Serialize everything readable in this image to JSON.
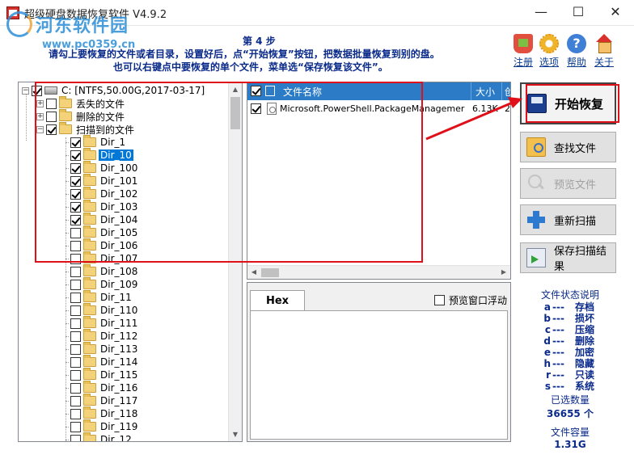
{
  "window": {
    "title": "超级硬盘数据恢复软件 V4.9.2",
    "min": "—",
    "max": "☐",
    "close": "✕"
  },
  "watermark": {
    "name": "河东软件园",
    "url": "www.pc0359.cn"
  },
  "instructions": {
    "step": "第 4 步",
    "line1": "请勾上要恢复的文件或者目录，设置好后，点“开始恢复”按钮，把数据批量恢复到别的盘。",
    "line2": "也可以右键点中要恢复的单个文件，菜单选“保存恢复该文件”。"
  },
  "toolbar": {
    "register": "注册",
    "options": "选项",
    "help": "帮助",
    "about": "关于"
  },
  "tree": {
    "drive": "C:  [NTFS,50.00G,2017-03-17]",
    "lost": "丢失的文件",
    "deleted": "删除的文件",
    "scanned": "扫描到的文件",
    "dirs": [
      "Dir_1",
      "Dir_10",
      "Dir_100",
      "Dir_101",
      "Dir_102",
      "Dir_103",
      "Dir_104",
      "Dir_105",
      "Dir_106",
      "Dir_107",
      "Dir_108",
      "Dir_109",
      "Dir_11",
      "Dir_110",
      "Dir_111",
      "Dir_112",
      "Dir_113",
      "Dir_114",
      "Dir_115",
      "Dir_116",
      "Dir_117",
      "Dir_118",
      "Dir_119",
      "Dir_12"
    ]
  },
  "filelist": {
    "col_name": "文件名称",
    "col_size": "大小",
    "col_more": "创",
    "rows": [
      {
        "name": "Microsoft.PowerShell.PackageManagemer",
        "size": "6.13K",
        "extra": "2"
      }
    ]
  },
  "hex": {
    "tab": "Hex",
    "float_label": "预览窗口浮动"
  },
  "buttons": {
    "start": "开始恢复",
    "find": "查找文件",
    "preview": "预览文件",
    "rescan": "重新扫描",
    "save_scan": "保存扫描结果"
  },
  "legend": {
    "title": "文件状态说明",
    "rows": [
      {
        "k": "a",
        "v": "存档"
      },
      {
        "k": "b",
        "v": "损坏"
      },
      {
        "k": "c",
        "v": "压缩"
      },
      {
        "k": "d",
        "v": "删除"
      },
      {
        "k": "e",
        "v": "加密"
      },
      {
        "k": "h",
        "v": "隐藏"
      },
      {
        "k": "r",
        "v": "只读"
      },
      {
        "k": "s",
        "v": "系统"
      }
    ],
    "dash": "---",
    "selected_label": "已选数量",
    "selected_value": "36655 个",
    "capacity_label": "文件容量",
    "capacity_value": "1.31G"
  },
  "colors": {
    "header_blue": "#2b7bc6",
    "annotation_red": "#e0101a",
    "text_blue": "#0a2a8a"
  }
}
